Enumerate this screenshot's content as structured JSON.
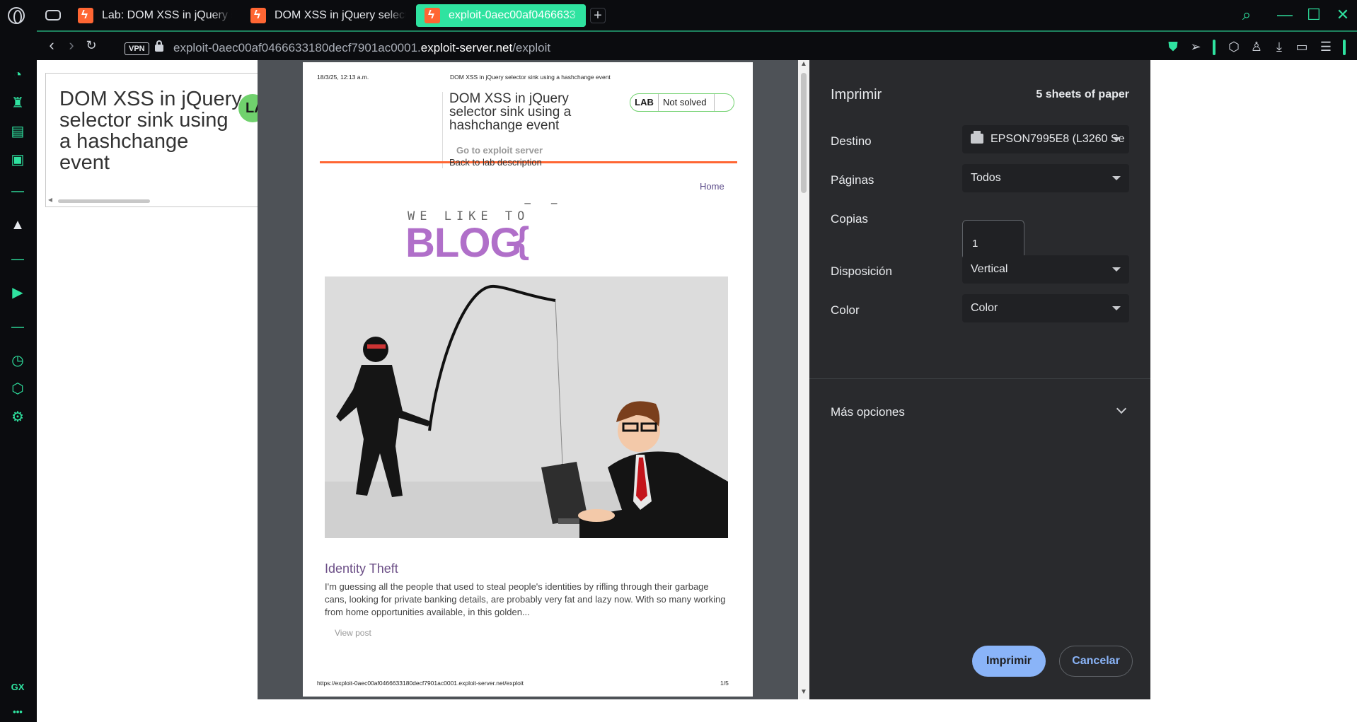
{
  "browser": {
    "tabs": [
      {
        "title": "Lab: DOM XSS in jQuery se"
      },
      {
        "title": "DOM XSS in jQuery selecto"
      },
      {
        "title": "exploit-0aec00af0466633"
      }
    ],
    "vpn_label": "VPN",
    "url_prefix": "exploit-0aec00af0466633180decf7901ac0001.",
    "url_host": "exploit-server.net",
    "url_path": "/exploit",
    "sidebar_gx_label": "GX",
    "sidebar_more_label": "•••",
    "accent_color": "#2fe3a0"
  },
  "page": {
    "heading": "DOM XSS in jQuery selector sink using a hashchange event",
    "lab_badge_partial": "LA"
  },
  "preview": {
    "header_date": "18/3/25, 12:13 a.m.",
    "header_title": "DOM XSS in jQuery selector sink using a hashchange event",
    "title": "DOM XSS in jQuery selector sink using a hashchange event",
    "lab_label": "LAB",
    "lab_status": "Not solved",
    "link_exploit": "Go to exploit server",
    "link_back": "Back to lab description",
    "home_link": "Home",
    "blog_small": "WE LIKE TO",
    "blog_big": "BLOG",
    "post_title": "Identity Theft",
    "post_body": "I'm guessing all the people that used to steal people's identities by rifling through their garbage cans, looking for private banking details, are probably very fat and lazy now. With so many working from home opportunities available, in this golden...",
    "view_post": "View post",
    "footer_url": "https://exploit-0aec00af0466633180decf7901ac0001.exploit-server.net/exploit",
    "footer_page": "1/5"
  },
  "print": {
    "title": "Imprimir",
    "sheets": "5 sheets of paper",
    "destination_label": "Destino",
    "destination_value": "EPSON7995E8 (L3260 Se",
    "pages_label": "Páginas",
    "pages_value": "Todos",
    "copies_label": "Copias",
    "copies_value": "1",
    "layout_label": "Disposición",
    "layout_value": "Vertical",
    "color_label": "Color",
    "color_value": "Color",
    "more_options": "Más opciones",
    "print_button": "Imprimir",
    "cancel_button": "Cancelar"
  }
}
